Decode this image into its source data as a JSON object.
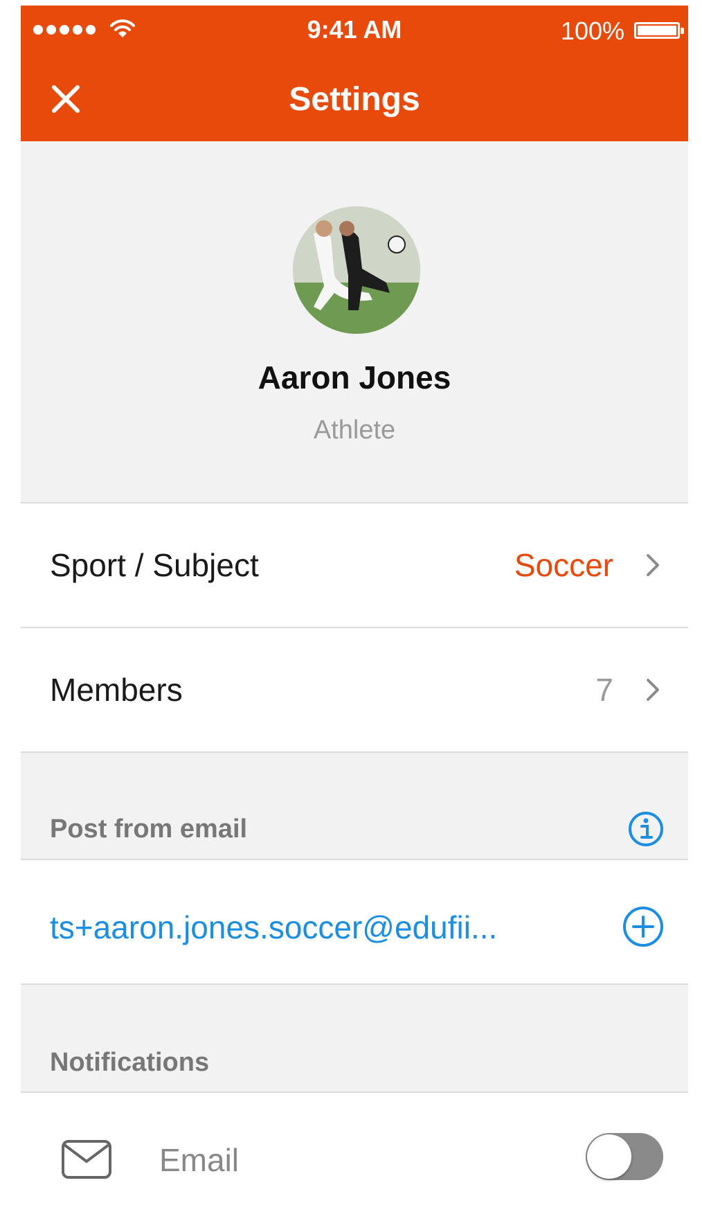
{
  "status_bar": {
    "time": "9:41 AM",
    "battery_percent": "100%"
  },
  "header": {
    "title": "Settings"
  },
  "profile": {
    "name": "Aaron Jones",
    "role": "Athlete"
  },
  "settings_rows": [
    {
      "label": "Sport / Subject",
      "value": "Soccer"
    },
    {
      "label": "Members",
      "value": "7"
    }
  ],
  "post_from_email": {
    "section_title": "Post from email",
    "address": "ts+aaron.jones.soccer@edufii..."
  },
  "notifications": {
    "section_title": "Notifications",
    "email_label": "Email",
    "email_enabled": false
  },
  "colors": {
    "brand": "#e84a0c",
    "link": "#1b8de3",
    "accent_value": "#e84a0c"
  },
  "icons": [
    "close-icon",
    "chevron-right-icon",
    "info-icon",
    "plus-circle-icon",
    "mail-icon"
  ]
}
